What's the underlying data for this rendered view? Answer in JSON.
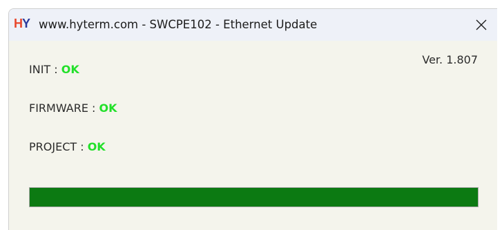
{
  "window": {
    "title": "www.hyterm.com - SWCPE102 - Ethernet Update",
    "logo": {
      "h": "H",
      "y": "Y"
    },
    "close_icon": "close-icon"
  },
  "version": "Ver. 1.807",
  "status": [
    {
      "label": "INIT : ",
      "value": "OK"
    },
    {
      "label": "FIRMWARE : ",
      "value": "OK"
    },
    {
      "label": "PROJECT : ",
      "value": "OK"
    }
  ],
  "progress": {
    "percent": 100
  },
  "colors": {
    "ok": "#22e02a",
    "progress_fill": "#0c7a12",
    "logo_h": "#e8472c",
    "logo_y": "#2a3a9c"
  }
}
